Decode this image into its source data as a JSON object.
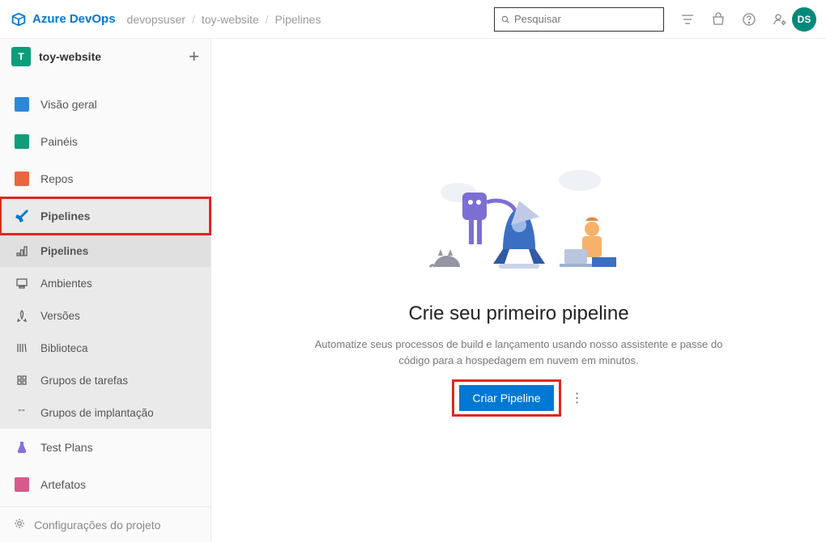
{
  "header": {
    "brand": "Azure DevOps",
    "breadcrumb": [
      "devopsuser",
      "toy-website",
      "Pipelines"
    ],
    "search_placeholder": "Pesquisar",
    "avatar_initials": "DS"
  },
  "sidebar": {
    "project_badge": "T",
    "project_name": "toy-website",
    "items": [
      {
        "label": "Visão geral",
        "icon": "overview-icon",
        "color": "#0078d4"
      },
      {
        "label": "Painéis",
        "icon": "boards-icon",
        "color": "#0e9e78"
      },
      {
        "label": "Repos",
        "icon": "repos-icon",
        "color": "#e8663d"
      },
      {
        "label": "Pipelines",
        "icon": "pipelines-icon",
        "color": "#0078d4"
      }
    ],
    "sub_items": [
      {
        "label": "Pipelines",
        "icon": "pipelines-sub-icon"
      },
      {
        "label": "Ambientes",
        "icon": "environments-icon"
      },
      {
        "label": "Versões",
        "icon": "releases-icon"
      },
      {
        "label": "Biblioteca",
        "icon": "library-icon"
      },
      {
        "label": "Grupos de tarefas",
        "icon": "taskgroups-icon"
      },
      {
        "label": "Grupos de implantação",
        "icon": "deployment-groups-icon"
      }
    ],
    "items_after": [
      {
        "label": "Test Plans",
        "icon": "testplans-icon",
        "color": "#8a6fe2"
      },
      {
        "label": "Artefatos",
        "icon": "artifacts-icon",
        "color": "#d75a8a"
      }
    ],
    "footer": "Configurações do projeto"
  },
  "main": {
    "title": "Crie seu primeiro pipeline",
    "subtitle": "Automatize seus processos de build e lançamento usando nosso assistente e passe do código para a hospedagem em nuvem em minutos.",
    "cta": "Criar Pipeline"
  }
}
